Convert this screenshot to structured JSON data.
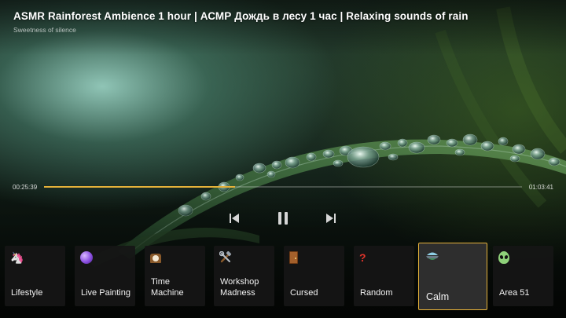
{
  "video": {
    "title": "ASMR Rainforest Ambience 1 hour | АСМР Дождь в лесу 1 час | Relaxing sounds of rain",
    "subtitle": "Sweetness of silence"
  },
  "player": {
    "elapsed": "00:25:39",
    "total": "01:03:41",
    "progress": 0.4
  },
  "controls": {
    "previous": "skip-back-icon",
    "pause": "pause-icon",
    "next": "skip-forward-icon"
  },
  "categories": [
    {
      "label": "Lifestyle",
      "icon": "unicorn-icon",
      "selected": false
    },
    {
      "label": "Live Painting",
      "icon": "crystal-ball-icon",
      "selected": false
    },
    {
      "label": "Time Machine",
      "icon": "mantelpiece-clock-icon",
      "selected": false
    },
    {
      "label": "Workshop Madness",
      "icon": "hammer-wrench-icon",
      "selected": false
    },
    {
      "label": "Cursed",
      "icon": "door-icon",
      "selected": false
    },
    {
      "label": "Random",
      "icon": "question-mark-icon",
      "selected": false
    },
    {
      "label": "Calm",
      "icon": "calm-landscape-icon",
      "selected": true
    },
    {
      "label": "Area 51",
      "icon": "alien-icon",
      "selected": false
    }
  ],
  "colors": {
    "accent": "#e6b23a",
    "card_background": "#161616"
  }
}
